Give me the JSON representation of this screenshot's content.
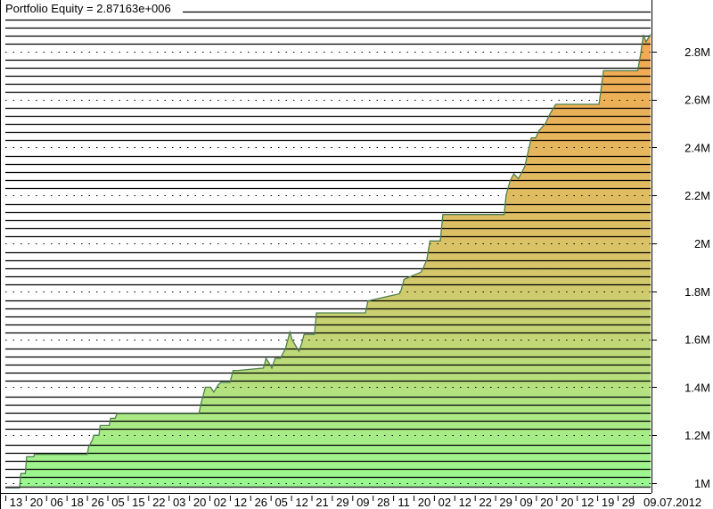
{
  "chart_data": {
    "type": "area",
    "title": "Portfolio Equity = 2.87163e+006",
    "series": [
      {
        "name": "Portfolio Equity",
        "x": [
          0,
          2.2,
          2.4,
          3.1,
          3.3,
          4.4,
          4.5,
          12.7,
          12.9,
          13.5,
          13.7,
          14.5,
          14.7,
          16.1,
          16.3,
          17.0,
          17.3,
          30.0,
          30.3,
          30.7,
          31.0,
          31.8,
          32.3,
          33.0,
          33.4,
          34.8,
          35.3,
          36.0,
          40.0,
          40.4,
          40.9,
          41.3,
          41.8,
          42.6,
          43.4,
          44.1,
          44.4,
          45.5,
          45.9,
          46.3,
          46.8,
          47.9,
          48.2,
          55.8,
          56.2,
          61.1,
          61.4,
          61.8,
          64.4,
          64.8,
          65.3,
          65.8,
          67.4,
          67.8,
          72.4,
          77.3,
          77.6,
          78.2,
          78.8,
          79.5,
          80.5,
          81.5,
          82.2,
          82.7,
          83.7,
          84.4,
          85.3,
          92.0,
          92.3,
          92.7,
          98.0,
          98.4,
          98.9,
          99.3,
          100
        ],
        "values": [
          980000,
          980000,
          1040000,
          1040000,
          1110000,
          1110000,
          1120000,
          1120000,
          1150000,
          1180000,
          1200000,
          1200000,
          1240000,
          1240000,
          1270000,
          1270000,
          1290000,
          1290000,
          1330000,
          1370000,
          1400000,
          1400000,
          1380000,
          1410000,
          1420000,
          1420000,
          1470000,
          1470000,
          1480000,
          1520000,
          1500000,
          1480000,
          1520000,
          1520000,
          1560000,
          1630000,
          1600000,
          1550000,
          1580000,
          1620000,
          1620000,
          1620000,
          1710000,
          1710000,
          1760000,
          1790000,
          1810000,
          1850000,
          1880000,
          1900000,
          1930000,
          2010000,
          2010000,
          2120000,
          2120000,
          2120000,
          2200000,
          2260000,
          2290000,
          2270000,
          2320000,
          2440000,
          2440000,
          2470000,
          2500000,
          2540000,
          2580000,
          2580000,
          2640000,
          2720000,
          2720000,
          2780000,
          2870000,
          2840000,
          2871630
        ]
      }
    ],
    "xlabel": "",
    "ylabel": "",
    "ylim": [
      950000,
      2950000
    ],
    "yticks": [
      1000000,
      1200000,
      1400000,
      1600000,
      1800000,
      2000000,
      2200000,
      2400000,
      2600000,
      2800000
    ],
    "ytick_labels": [
      "1M",
      "1.2M",
      "1.4M",
      "1.6M",
      "1.8M",
      "2M",
      "2.2M",
      "2.4M",
      "2.6M",
      "2.8M"
    ],
    "xtick_labels": [
      "13",
      "20",
      "06",
      "18",
      "26",
      "05",
      "15",
      "22",
      "03",
      "20",
      "02",
      "12",
      "26",
      "05",
      "12",
      "21",
      "29",
      "09",
      "28",
      "11",
      "20",
      "02",
      "12",
      "22",
      "29",
      "09",
      "20",
      "20",
      "12",
      "19",
      "29",
      "09.07.2012"
    ],
    "grid": true,
    "colors": {
      "fill_bottom": "#98f890",
      "fill_mid": "#d8c468",
      "fill_top": "#f4a850",
      "line": "#4f7f4f"
    }
  }
}
